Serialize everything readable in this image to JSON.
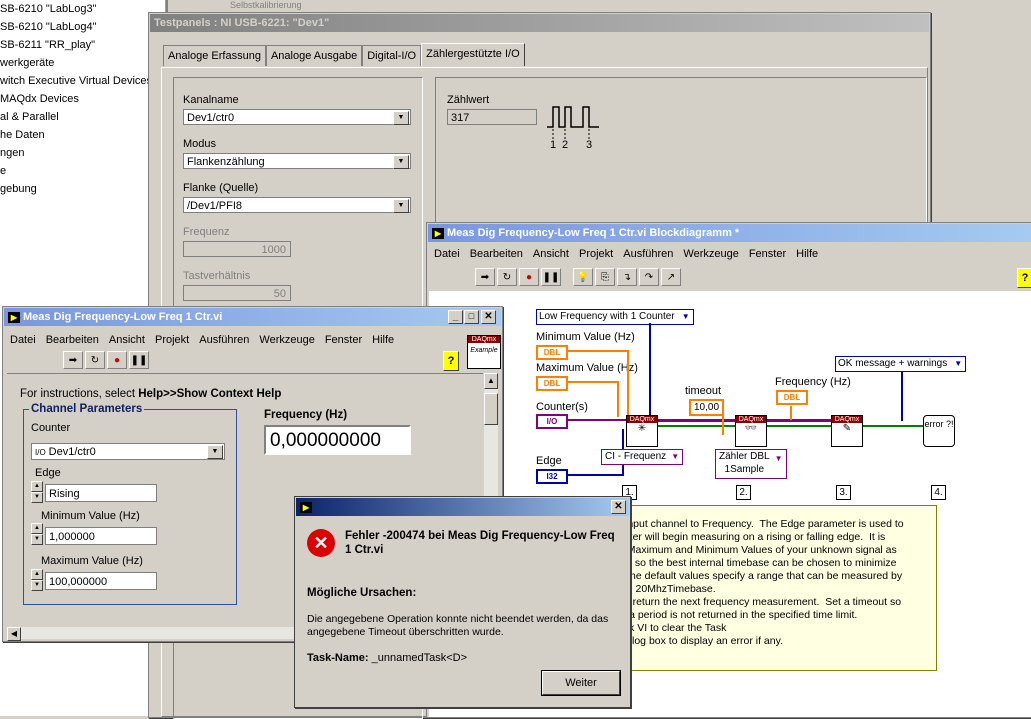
{
  "tree": {
    "items": [
      "SB-6210 \"LabLog3\"",
      "SB-6210 \"LabLog4\"",
      "SB-6211 \"RR_play\"",
      "werkgeräte",
      "witch Executive Virtual Devices",
      "MAQdx Devices",
      "al & Parallel",
      "he Daten",
      "ngen",
      "e",
      "gebung"
    ]
  },
  "testpanel": {
    "title": "Testpanels : NI USB-6221: \"Dev1\"",
    "top_text": "Selbstkalibrierung",
    "tabs": [
      "Analoge Erfassung",
      "Analoge Ausgabe",
      "Digital-I/O",
      "Zählergestützte I/O"
    ],
    "kanalname_label": "Kanalname",
    "kanalname_value": "Dev1/ctr0",
    "modus_label": "Modus",
    "modus_value": "Flankenzählung",
    "flanke_label": "Flanke (Quelle)",
    "flanke_value": "/Dev1/PFI8",
    "frequenz_label": "Frequenz",
    "frequenz_value": "1000",
    "tast_label": "Tastverhältnis",
    "tast_value": "50",
    "zaehlwert_label": "Zählwert",
    "zaehlwert_value": "317",
    "pulse_labels": [
      "1",
      "2",
      "3"
    ]
  },
  "block": {
    "title": "Meas Dig Frequency-Low Freq 1 Ctr.vi Blockdiagramm *",
    "menu": [
      "Datei",
      "Bearbeiten",
      "Ansicht",
      "Projekt",
      "Ausführen",
      "Werkzeuge",
      "Fenster",
      "Hilfe"
    ],
    "ring_label": "Low Frequency with 1 Counter",
    "min_label": "Minimum Value (Hz)",
    "min_term": "DBL",
    "max_label": "Maximum Value (Hz)",
    "max_term": "DBL",
    "counter_label": "Counter(s)",
    "counter_term": "I/O",
    "edge_label": "Edge",
    "edge_term": "I32",
    "timeout_label": "timeout",
    "timeout_value": "10,00",
    "freq_label": "Frequency (Hz)",
    "freq_term": "DBL",
    "msg_ring": "OK message + warnings",
    "ci_ring": "CI - Frequenz",
    "zaehler_ring1": "Zähler DBL",
    "zaehler_ring2": "1Sample",
    "node_label": "DAQmx",
    "error_label": "error ?!",
    "steps": [
      "1.",
      "2.",
      "3.",
      "4."
    ],
    "comment_lines": [
      "r Input channel to Frequency.  The Edge parameter is used to",
      "unter will begin measuring on a rising or falling edge.  It is",
      "e Maximum and Minimum Values of your unknown signal as",
      "ble so the best internal timebase can be chosen to minimize",
      "  The default values specify a range that can be measured by",
      "the 20MhzTimebase.",
      " to return the next frequency measurement.  Set a timeout so",
      " if a period is not returned in the specified time limit.",
      "ask VI to clear the Task",
      "dialog box to display an error if any."
    ]
  },
  "front": {
    "title": "Meas Dig Frequency-Low Freq 1 Ctr.vi",
    "menu": [
      "Datei",
      "Bearbeiten",
      "Ansicht",
      "Projekt",
      "Ausführen",
      "Werkzeuge",
      "Fenster",
      "Hilfe"
    ],
    "instructions_prefix": "For instructions, select ",
    "instructions_bold": "Help>>Show Context Help",
    "group_label": "Channel Parameters",
    "counter_label": "Counter",
    "counter_value": "Dev1/ctr0",
    "edge_label": "Edge",
    "edge_value": "Rising",
    "min_label": "Minimum Value (Hz)",
    "min_value": "1,000000",
    "max_label": "Maximum Value (Hz)",
    "max_value": "100,000000",
    "freq_label": "Frequency (Hz)",
    "freq_value": "0,000000000",
    "daq_icon_top": "DAQmx",
    "daq_icon_bottom": "Example"
  },
  "dialog": {
    "title": "",
    "heading": "Fehler -200474 bei Meas Dig Frequency-Low Freq 1 Ctr.vi",
    "causes_label": "Mögliche Ursachen:",
    "message": "Die angegebene Operation konnte nicht beendet werden, da das angegebene Timeout überschritten wurde.",
    "task_label": "Task-Name: ",
    "task_value": "_unnamedTask<D>",
    "button": "Weiter"
  }
}
